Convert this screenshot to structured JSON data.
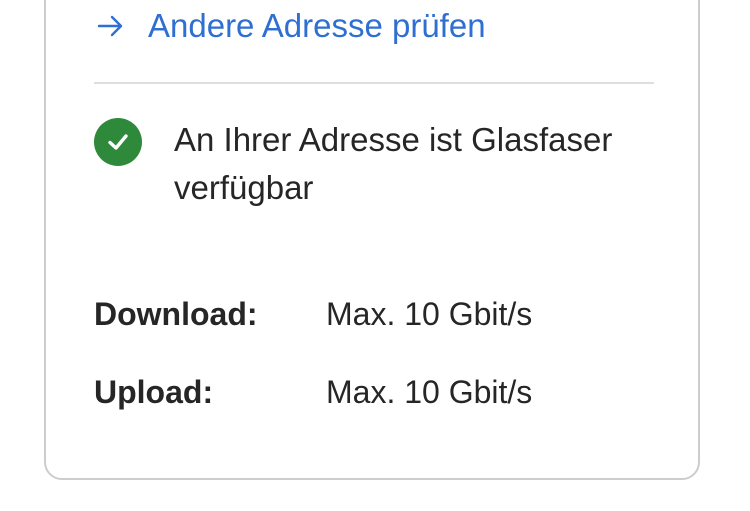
{
  "link": {
    "label": "Andere Adresse prüfen",
    "icon": "arrow-right-icon",
    "color": "#2f6fd1"
  },
  "status": {
    "icon": "checkmark-circle-icon",
    "icon_color": "#2e8a3a",
    "text": "An Ihrer Adresse ist Glasfaser verfügbar"
  },
  "specs": [
    {
      "label": "Download:",
      "value": "Max. 10 Gbit/s"
    },
    {
      "label": "Upload:",
      "value": "Max. 10 Gbit/s"
    }
  ]
}
